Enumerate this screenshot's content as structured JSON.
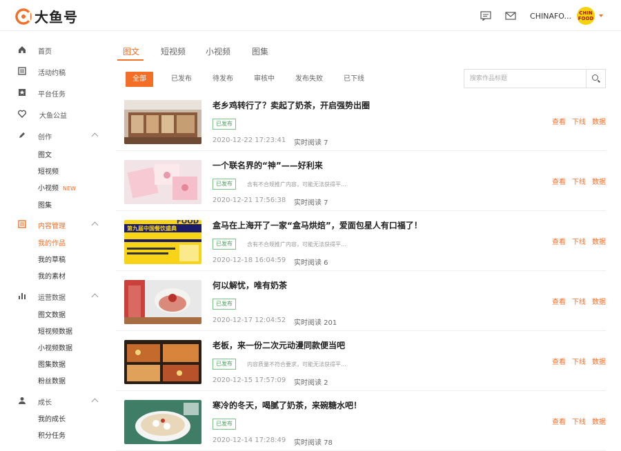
{
  "brand": {
    "logo_text": "大鱼号",
    "accent": "#f36f28"
  },
  "header": {
    "user_name": "CHINAFO...",
    "avatar_text_1": "CHIN",
    "avatar_text_2": "FOOD"
  },
  "sidebar": {
    "home": "首页",
    "activity": "活动约稿",
    "tasks": "平台任务",
    "charity": "大鱼公益",
    "create": {
      "label": "创作",
      "subs": [
        "图文",
        "短视频",
        "小视频",
        "图集"
      ],
      "new_badge": "NEW"
    },
    "content": {
      "label": "内容管理",
      "subs": [
        "我的作品",
        "我的草稿",
        "我的素材"
      ]
    },
    "data": {
      "label": "运营数据",
      "subs": [
        "图文数据",
        "短视频数据",
        "小视频数据",
        "图集数据",
        "粉丝数据"
      ]
    },
    "growth": {
      "label": "成长",
      "subs": [
        "我的成长",
        "积分任务"
      ]
    }
  },
  "tabs": [
    "图文",
    "短视频",
    "小视频",
    "图集"
  ],
  "filters": [
    "全部",
    "已发布",
    "待发布",
    "审核中",
    "发布失败",
    "已下线"
  ],
  "search": {
    "placeholder": "搜索作品标题"
  },
  "actions": {
    "view": "查看",
    "offline": "下线",
    "data": "数据"
  },
  "articles": [
    {
      "title": "老乡鸡转行了？卖起了奶茶，开启强势出圈",
      "status": "已发布",
      "note": "",
      "date": "2020-12-22 17:23:41",
      "reads": "实时阅读 7",
      "thumb": "shop"
    },
    {
      "title": "一个联名界的“神”——好利来",
      "status": "已发布",
      "note": "含有不合规推广内容，可能无法获得平...",
      "date": "2020-12-21 17:56:38",
      "reads": "实时阅读 7",
      "thumb": "pink"
    },
    {
      "title": "盒马在上海开了一家“盒马烘焙”，爱面包星人有口福了！",
      "status": "已发布",
      "note": "含有不合规推广内容，可能无法获得平...",
      "date": "2020-12-18 16:04:59",
      "reads": "实时阅读 6",
      "thumb": "poster",
      "thumb_title": "第九届中国餐饮盛典",
      "thumb_word": "FOOD"
    },
    {
      "title": "何以解忧，唯有奶茶",
      "status": "已发布",
      "note": "",
      "date": "2020-12-17 12:04:52",
      "reads": "实时阅读 201",
      "thumb": "tea"
    },
    {
      "title": "老板，来一份二次元动漫同款便当吧",
      "status": "已发布",
      "note": "内容质量不符合要求，可能无法获得平...",
      "date": "2020-12-15 17:57:09",
      "reads": "实时阅读 2",
      "thumb": "bento"
    },
    {
      "title": "寒冷的冬天，喝腻了奶茶，来碗糖水吧！",
      "status": "已发布",
      "note": "",
      "date": "2020-12-14 17:28:49",
      "reads": "实时阅读 78",
      "thumb": "bowl"
    }
  ]
}
